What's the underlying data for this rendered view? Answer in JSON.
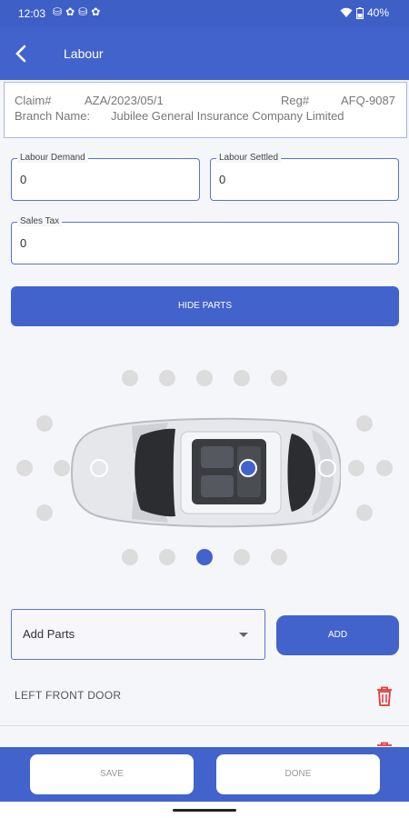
{
  "status_bar": {
    "time": "12:03",
    "battery": "40%"
  },
  "app_bar": {
    "title": "Labour"
  },
  "claim_info": {
    "claim_label": "Claim#",
    "claim_value": "AZA/2023/05/1",
    "reg_label": "Reg#",
    "reg_value": "AFQ-9087",
    "branch_label": "Branch Name:",
    "branch_value": "Jubilee General Insurance Company Limited"
  },
  "form": {
    "labour_demand_label": "Labour Demand",
    "labour_demand_value": "0",
    "labour_settled_label": "Labour Settled",
    "labour_settled_value": "0",
    "sales_tax_label": "Sales Tax",
    "sales_tax_value": "0"
  },
  "hide_parts_label": "HIDE PARTS",
  "parts": {
    "dropdown_value": "Add Parts",
    "add_label": "ADD",
    "list": [
      {
        "name": "LEFT FRONT DOOR"
      }
    ]
  },
  "bottom": {
    "save_label": "SAVE",
    "done_label": "DONE"
  },
  "colors": {
    "primary": "#4263cc",
    "delete": "#e53935",
    "selected_dot": "#4263cc"
  }
}
